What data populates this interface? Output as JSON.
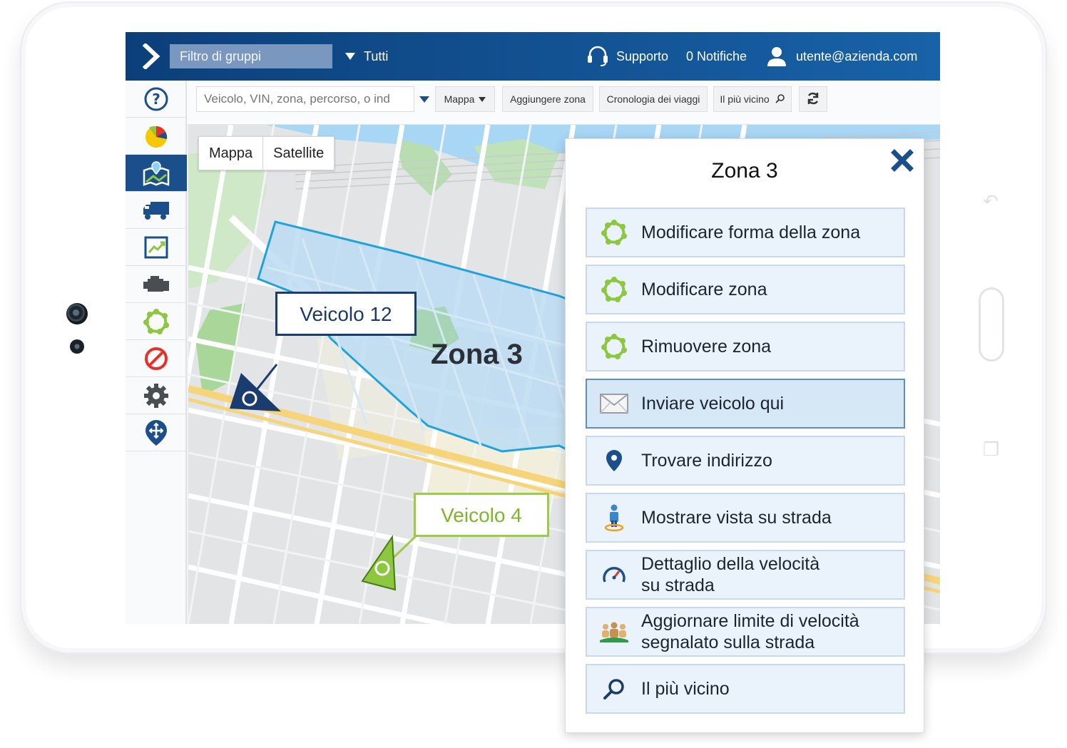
{
  "header": {
    "group_filter_placeholder": "Filtro di gruppi",
    "group_value": "Tutti",
    "support_label": "Supporto",
    "notifications_label": "0 Notifiche",
    "user_email": "utente@azienda.com"
  },
  "toolbar": {
    "search_placeholder": "Veicolo, VIN, zona, percorso, o ind",
    "map_label": "Mappa",
    "add_zone_label": "Aggiungere zona",
    "trip_history_label": "Cronologia dei viaggi",
    "nearest_label": "Il più vicino"
  },
  "map": {
    "type_buttons": [
      "Mappa",
      "Satellite"
    ],
    "zone_name": "Zona 3",
    "vehicles": [
      {
        "label": "Veicolo 12",
        "color": "#1b3c6e"
      },
      {
        "label": "Veicolo 4",
        "color": "#8dc63f"
      }
    ]
  },
  "panel": {
    "title": "Zona 3",
    "items": [
      {
        "label": "Modificare forma della zona",
        "icon": "zone-shape-icon"
      },
      {
        "label": "Modificare zona",
        "icon": "zone-edit-icon"
      },
      {
        "label": "Rimuovere zona",
        "icon": "zone-remove-icon"
      },
      {
        "label": "Inviare veicolo qui",
        "icon": "envelope-icon"
      },
      {
        "label": "Trovare indirizzo",
        "icon": "location-pin-icon"
      },
      {
        "label": "Mostrare vista su strada",
        "icon": "street-view-icon"
      },
      {
        "label": "Dettaglio della velocità",
        "label2": "su strada",
        "icon": "speedometer-icon"
      },
      {
        "label": "Aggiornare limite di velocità",
        "label2": "segnalato sulla strada",
        "icon": "people-group-icon"
      },
      {
        "label": "Il più vicino",
        "icon": "search-icon"
      }
    ]
  },
  "colors": {
    "header_dark": "#0c3f7a",
    "header_light": "#1862a8",
    "zone_fill": "#bcdcf2",
    "zone_border": "#1fa3dc",
    "accent_green": "#8dc63f"
  }
}
